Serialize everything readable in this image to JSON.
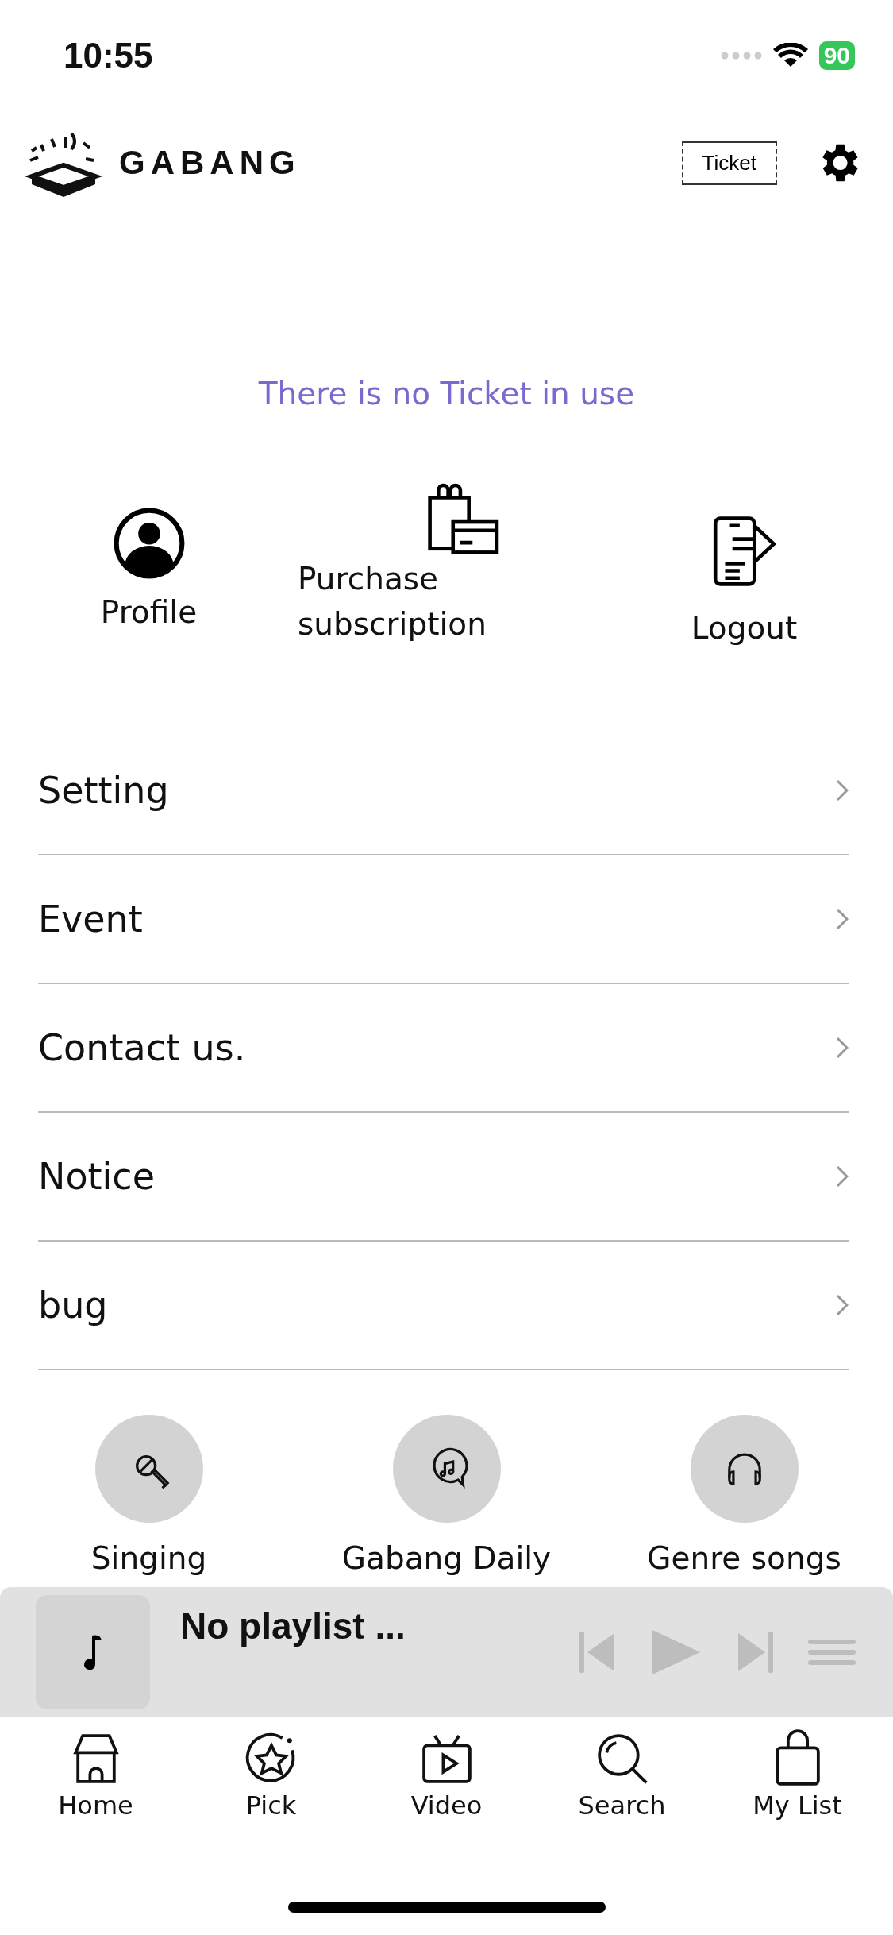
{
  "status_bar": {
    "time": "10:55",
    "battery": "90"
  },
  "header": {
    "logo": "GABANG",
    "ticket_button": "Ticket"
  },
  "ticket_status": "There is no Ticket in use",
  "shortcuts": [
    {
      "kind": "profile",
      "label": "Profile"
    },
    {
      "kind": "purchase",
      "label": "Purchase subscription"
    },
    {
      "kind": "logout",
      "label": "Logout"
    }
  ],
  "menu": [
    {
      "label": "Setting"
    },
    {
      "label": "Event"
    },
    {
      "label": "Contact us."
    },
    {
      "label": "Notice"
    },
    {
      "label": "bug"
    }
  ],
  "categories": [
    {
      "kind": "mic",
      "label": "Singing"
    },
    {
      "kind": "chat",
      "label": "Gabang Daily"
    },
    {
      "kind": "headphones",
      "label": "Genre songs"
    }
  ],
  "player": {
    "title": "No playlist ...",
    "disabled": true
  },
  "tabs": [
    {
      "kind": "home",
      "label": "Home"
    },
    {
      "kind": "pick",
      "label": "Pick"
    },
    {
      "kind": "video",
      "label": "Video"
    },
    {
      "kind": "search",
      "label": "Search"
    },
    {
      "kind": "list",
      "label": "My List"
    }
  ]
}
